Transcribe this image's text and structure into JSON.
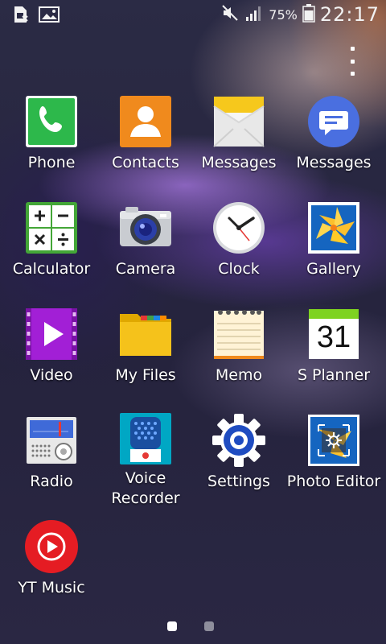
{
  "status_bar": {
    "battery_percent": "75%",
    "time": "22:17",
    "left_icons": [
      "sim-card-icon",
      "gallery-notification-icon"
    ],
    "right_icons": [
      "mute-icon",
      "signal-icon",
      "battery-icon"
    ]
  },
  "apps": [
    {
      "label": "Phone",
      "icon": "phone-icon"
    },
    {
      "label": "Contacts",
      "icon": "contacts-icon"
    },
    {
      "label": "Messages",
      "icon": "messages-envelope-icon"
    },
    {
      "label": "Messages",
      "icon": "messages-bubble-icon"
    },
    {
      "label": "Calculator",
      "icon": "calculator-icon"
    },
    {
      "label": "Camera",
      "icon": "camera-icon"
    },
    {
      "label": "Clock",
      "icon": "clock-icon"
    },
    {
      "label": "Gallery",
      "icon": "gallery-icon"
    },
    {
      "label": "Video",
      "icon": "video-icon"
    },
    {
      "label": "My Files",
      "icon": "folder-icon"
    },
    {
      "label": "Memo",
      "icon": "memo-icon"
    },
    {
      "label": "S Planner",
      "icon": "calendar-icon",
      "badge": "31"
    },
    {
      "label": "Radio",
      "icon": "radio-icon"
    },
    {
      "label": "Voice\nRecorder",
      "icon": "microphone-icon"
    },
    {
      "label": "Settings",
      "icon": "settings-gear-icon"
    },
    {
      "label": "Photo Editor",
      "icon": "photo-editor-icon"
    },
    {
      "label": "YT Music",
      "icon": "yt-music-icon"
    }
  ],
  "pagination": {
    "pages": 2,
    "current": 1
  },
  "colors": {
    "phone": "#2db84b",
    "contacts": "#f08a1d",
    "messages_yellow": "#f6c81c",
    "messages_blue": "#4a6fe0",
    "calculator": "#43a637",
    "video": "#a21fd6",
    "folder": "#f5c21b",
    "settings": "#1f4cc1",
    "yt_red": "#e51c23"
  }
}
